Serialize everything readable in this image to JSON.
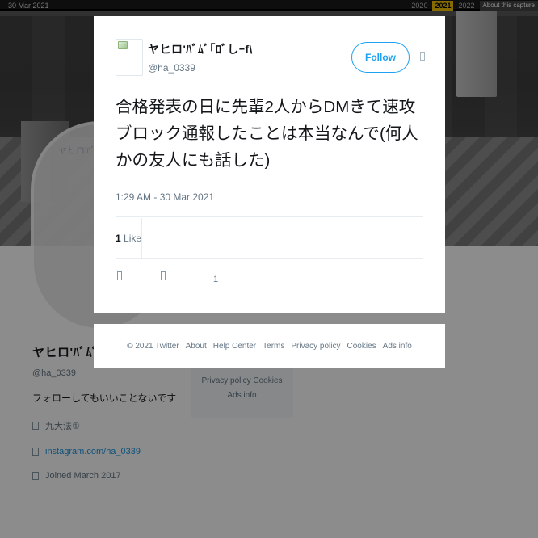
{
  "wayback": {
    "date_left": "30 Mar 2021",
    "year_prev": "2020",
    "year_current": "2021",
    "year_next": "2022",
    "about_label": "About this capture"
  },
  "profile": {
    "avatar_label": "ヤヒロ'ﾊﾞﾑﾞ｢ﾛﾞし",
    "name": "ヤヒロ'ﾊﾞﾑﾞ｢ﾛﾞし",
    "handle": "@ha_0339",
    "bio": "フォローしてもいいことないです",
    "location": "九大法①",
    "link": "instagram.com/ha_0339",
    "joined": "Joined March 2017",
    "background_footer": [
      "Privacy policy",
      "Cookies",
      "Ads info"
    ]
  },
  "tweet": {
    "author_name": "ヤヒロ'ﾊﾞﾑﾞ｢ﾛﾞしｰf\\",
    "author_handle": "@ha_0339",
    "follow_label": "Follow",
    "text": "合格発表の日に先輩2人からDMきて速攻ブロック通報したことは本当なんで(何人かの友人にも話した)",
    "timestamp": "1:29 AM - 30 Mar 2021",
    "likes_count": "1",
    "likes_label": "Like",
    "reply_count": "1",
    "accent_color": "#1da1f2"
  },
  "footer": {
    "copyright": "© 2021 Twitter",
    "links": [
      "About",
      "Help Center",
      "Terms",
      "Privacy policy",
      "Cookies",
      "Ads info"
    ]
  },
  "icons": {
    "caret": "chevron-down-icon",
    "reply": "reply-icon",
    "retweet": "retweet-icon",
    "like": "heart-icon"
  }
}
